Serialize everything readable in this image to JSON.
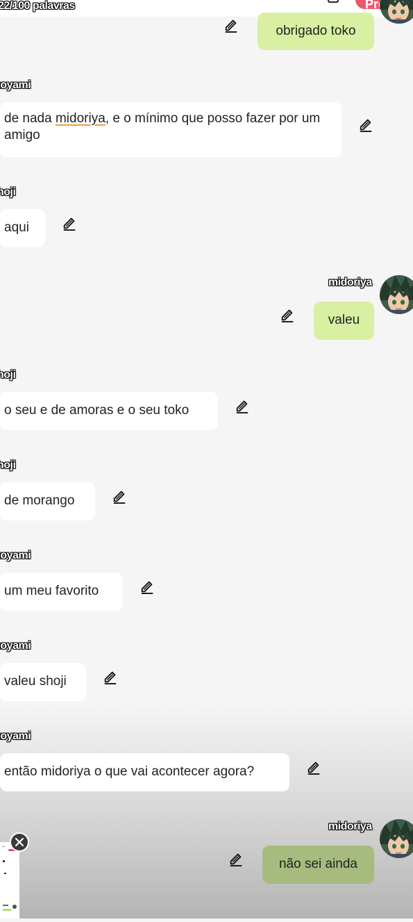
{
  "header": {
    "word_count": "22/100 palavras",
    "next_button": "Próximo"
  },
  "messages": [
    {
      "sender": "",
      "text": "obrigado toko",
      "side": "right"
    },
    {
      "sender": "tokoyami",
      "text_parts": [
        "de nada ",
        "midoriya",
        ", e o mínimo que posso fazer por um amigo"
      ],
      "side": "left"
    },
    {
      "sender": "shoji",
      "text": "aqui",
      "side": "left"
    },
    {
      "sender": "midoriya",
      "text": "valeu",
      "side": "right"
    },
    {
      "sender": "shoji",
      "text": "o seu e de amoras e o seu toko",
      "side": "left"
    },
    {
      "sender": "shoji",
      "text": "de morango",
      "side": "left"
    },
    {
      "sender": "tokoyami",
      "text": "um meu favorito",
      "side": "left"
    },
    {
      "sender": "tokoyami",
      "text": "valeu shoji",
      "side": "left"
    },
    {
      "sender": "tokoyami",
      "text": "então midoriya o que vai acontecer agora?",
      "side": "left"
    },
    {
      "sender": "midoriya",
      "text": "não sei ainda",
      "side": "right"
    }
  ],
  "name_tags": {
    "m1": "koyami",
    "m2": "hoji",
    "m3": "midoriya",
    "m4": "hoji",
    "m5": "hoji",
    "m6": "koyami",
    "m7": "koyami",
    "m8": "koyami",
    "m9": "midoriya"
  },
  "icons": {
    "edit": "pencil-edit-icon",
    "close": "close-icon",
    "avatar": "midoriya-avatar"
  },
  "colors": {
    "user_bubble": "#d9f0a3",
    "other_bubble": "#ffffff",
    "next_button": "#f0576e",
    "background": "#f5f5f5"
  }
}
